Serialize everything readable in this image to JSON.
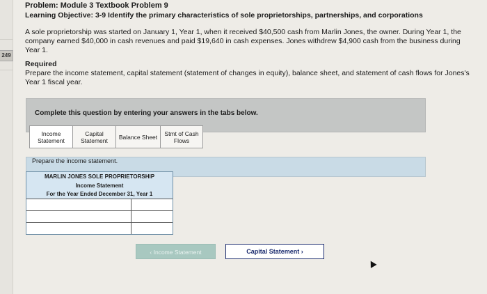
{
  "side": {
    "page_number": "249"
  },
  "problem": {
    "title": "Problem: Module 3 Textbook Problem 9",
    "objective": "Learning Objective: 3-9 Identify the primary characteristics of sole proprietorships, partnerships, and corporations",
    "narrative": "A sole proprietorship was started on January 1, Year 1, when it received $40,500 cash from Marlin Jones, the owner. During Year 1, the company earned $40,000 in cash revenues and paid $19,640 in cash expenses. Jones withdrew $4,900 cash from the business during Year 1.",
    "required_heading": "Required",
    "required_text": "Prepare the income statement, capital statement (statement of changes in equity), balance sheet, and statement of cash flows for Jones's Year 1 fiscal year."
  },
  "banner": {
    "text": "Complete this question by entering your answers in the tabs below."
  },
  "tabs": [
    {
      "label": "Income Statement"
    },
    {
      "label": "Capital Statement"
    },
    {
      "label": "Balance Sheet"
    },
    {
      "label": "Stmt of Cash Flows"
    }
  ],
  "panel": {
    "instruction": "Prepare the income statement."
  },
  "income_statement": {
    "company": "MARLIN JONES SOLE PROPRIETORSHIP",
    "title": "Income Statement",
    "period": "For the Year Ended December 31, Year 1",
    "rows": [
      {
        "label": "",
        "amount": ""
      },
      {
        "label": "",
        "amount": ""
      },
      {
        "label": "",
        "amount": ""
      }
    ]
  },
  "nav": {
    "prev_label": "Income Statement",
    "next_label": "Capital Statement"
  },
  "colors": {
    "accent": "#1a2b6e",
    "table_bg": "#d6e6f2",
    "panel_bg": "#c9dbe6",
    "banner_bg": "#c4c6c5"
  }
}
